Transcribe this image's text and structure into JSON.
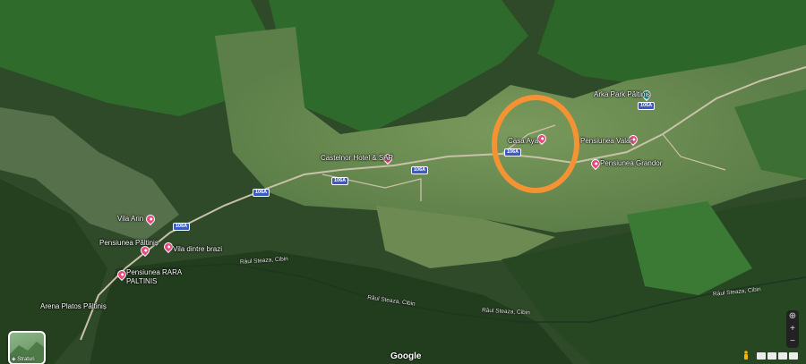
{
  "map": {
    "place_labels": [
      {
        "id": "arka-park",
        "text": "Arka Park Păltiniș"
      },
      {
        "id": "casa-aya",
        "text": "Casa Aya"
      },
      {
        "id": "pensiunea-valar",
        "text": "Pensiunea Valar"
      },
      {
        "id": "castelnor",
        "text": "Castelnor Hotel & SAP"
      },
      {
        "id": "pensiunea-grandor",
        "text": "Pensiunea Grandor"
      },
      {
        "id": "vila-arin",
        "text": "Vila Arin"
      },
      {
        "id": "pensiunea-paltinis",
        "text": "Pensiunea Păltiniș"
      },
      {
        "id": "vila-brazi",
        "text": "Vila dintre brazi"
      },
      {
        "id": "pensiunea-rara-1",
        "text": "Pensiunea RARA"
      },
      {
        "id": "pensiunea-rara-2",
        "text": "PALTINIS"
      },
      {
        "id": "arena",
        "text": "Arena Platos Păltiniș"
      }
    ],
    "road_labels": [
      {
        "id": "road-106a-1",
        "text": "106A"
      },
      {
        "id": "road-106a-2",
        "text": "106A"
      },
      {
        "id": "road-106a-3",
        "text": "106A"
      },
      {
        "id": "road-106a-4",
        "text": "106A"
      },
      {
        "id": "road-106a-5",
        "text": "106A"
      },
      {
        "id": "road-106a-6",
        "text": "106A"
      }
    ],
    "river_labels": [
      {
        "id": "river-1",
        "text": "Râul Steaza, Cibin"
      },
      {
        "id": "river-2",
        "text": "Râul Steaza, Cibin"
      },
      {
        "id": "river-3",
        "text": "Râul Steaza, Cibin"
      },
      {
        "id": "river-4",
        "text": "Râul Steaza, Cibin"
      }
    ],
    "colors": {
      "forest": "#2d4a28",
      "meadow": "#6f8f55",
      "highlight": "#f59233",
      "pin": "#e84a7f",
      "pin_teal": "#18a7a7"
    }
  },
  "controls": {
    "layers_label": "Straturi",
    "google": "Google",
    "zoom_in": "+",
    "zoom_out": "−",
    "compass": "⊕"
  }
}
